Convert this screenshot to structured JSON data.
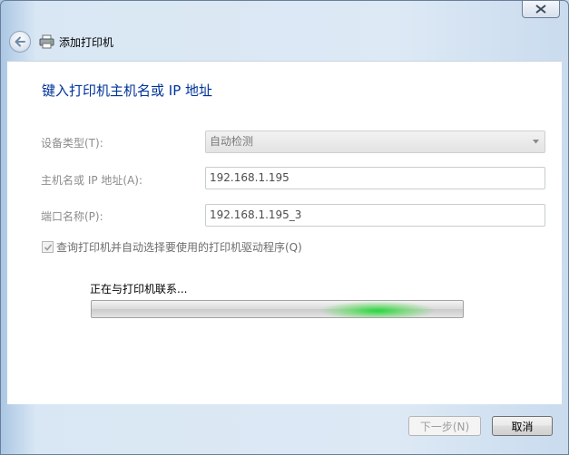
{
  "window": {
    "title": "添加打印机",
    "accent": "#003399"
  },
  "main": {
    "heading": "键入打印机主机名或 IP 地址",
    "device_type": {
      "label": "设备类型(T):",
      "value": "自动检测"
    },
    "host": {
      "label": "主机名或 IP 地址(A):",
      "value": "192.168.1.195"
    },
    "port": {
      "label": "端口名称(P):",
      "value": "192.168.1.195_3"
    },
    "query_checkbox": {
      "label": "查询打印机并自动选择要使用的打印机驱动程序(Q)",
      "checked": true
    },
    "progress": {
      "label": "正在与打印机联系..."
    }
  },
  "footer": {
    "next_label": "下一步(N)",
    "cancel_label": "取消"
  },
  "icons": {
    "close": "close-icon",
    "back": "back-arrow-icon",
    "printer": "printer-icon"
  }
}
